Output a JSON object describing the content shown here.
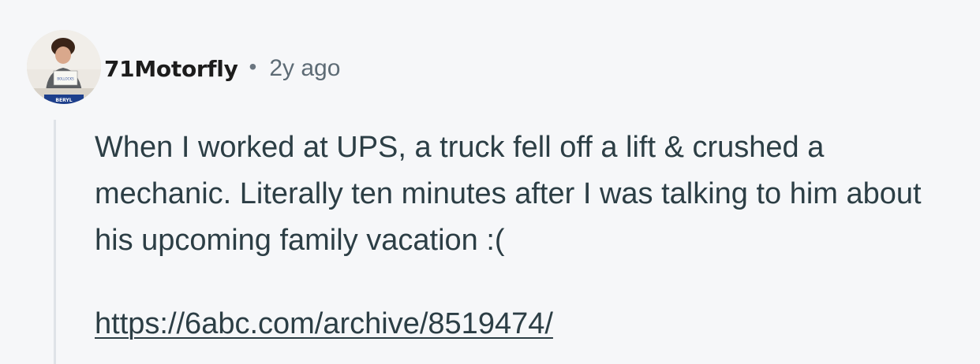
{
  "comment": {
    "username": "71Motorfly",
    "separator": "•",
    "timestamp": "2y ago",
    "body": "When I worked at UPS, a truck fell off a lift & crushed a mechanic. Literally ten minutes after I was talking to him about his upcoming family vacation :(",
    "link": "https://6abc.com/archive/8519474/",
    "avatar_sign_text": "BOLLOCKS",
    "avatar_name_plate": "BERYL"
  },
  "colors": {
    "background": "#f6f7f9",
    "username": "#1c1c1c",
    "text": "#2c3e45",
    "muted": "#5d6b75",
    "thread_line": "#dfe3e8"
  }
}
